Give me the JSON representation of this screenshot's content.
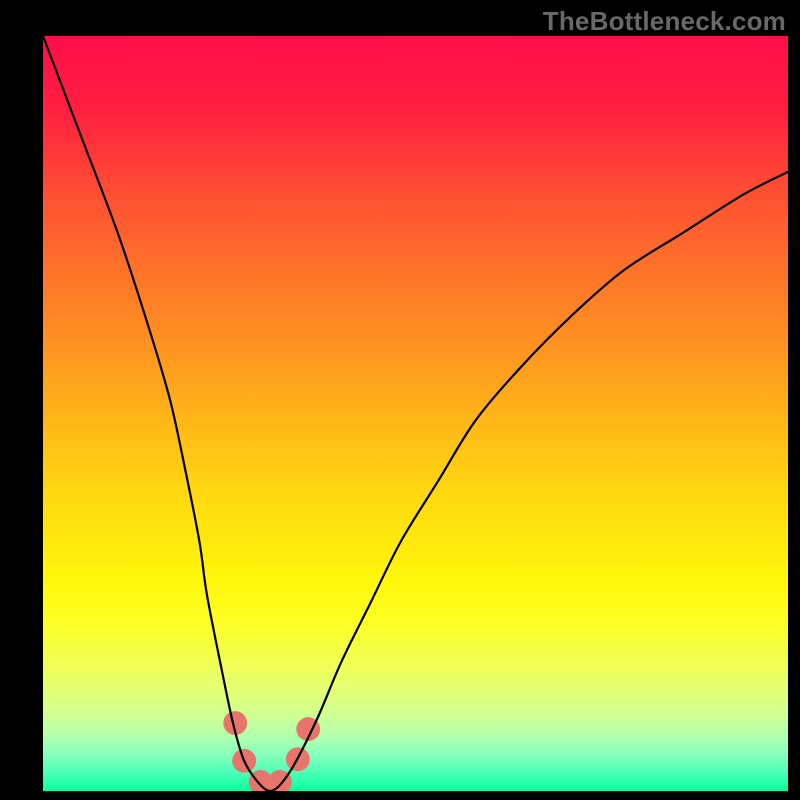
{
  "watermark": "TheBottleneck.com",
  "gradient": {
    "stops": [
      {
        "offset": 0.0,
        "color": "#ff0e49"
      },
      {
        "offset": 0.1,
        "color": "#ff2040"
      },
      {
        "offset": 0.2,
        "color": "#ff4b33"
      },
      {
        "offset": 0.3,
        "color": "#ff6f2a"
      },
      {
        "offset": 0.4,
        "color": "#ff8f22"
      },
      {
        "offset": 0.5,
        "color": "#ffb318"
      },
      {
        "offset": 0.6,
        "color": "#ffd610"
      },
      {
        "offset": 0.72,
        "color": "#fff60a"
      },
      {
        "offset": 0.77,
        "color": "#feff1f"
      },
      {
        "offset": 0.82,
        "color": "#f3ff4a"
      },
      {
        "offset": 0.86,
        "color": "#e6ff6f"
      },
      {
        "offset": 0.9,
        "color": "#cfff93"
      },
      {
        "offset": 0.925,
        "color": "#b5ffab"
      },
      {
        "offset": 0.95,
        "color": "#89ffbb"
      },
      {
        "offset": 0.975,
        "color": "#4effb7"
      },
      {
        "offset": 1.0,
        "color": "#06ff9f"
      }
    ]
  },
  "chart_data": {
    "type": "line",
    "title": "",
    "xlabel": "",
    "ylabel": "",
    "xlim": [
      0,
      100
    ],
    "ylim": [
      0,
      100
    ],
    "series": [
      {
        "name": "bottleneck-curve",
        "x": [
          0,
          5,
          10,
          14,
          17,
          19,
          21,
          22,
          24,
          25.5,
          27,
          29,
          30.5,
          32,
          34,
          37,
          40,
          44,
          48,
          53,
          58,
          64,
          71,
          78,
          86,
          94,
          100
        ],
        "values": [
          100,
          87,
          74,
          62,
          52,
          43,
          33,
          26,
          16,
          9,
          4,
          1,
          0,
          1,
          4,
          10,
          17,
          25,
          33,
          41,
          49,
          56,
          63,
          69,
          74,
          79,
          82
        ]
      }
    ],
    "markers": {
      "name": "marker-blobs",
      "color": "#e8756b",
      "points": [
        {
          "x": 25.8,
          "y": 9.0,
          "r": 1.6
        },
        {
          "x": 27.0,
          "y": 4.0,
          "r": 1.6
        },
        {
          "x": 29.2,
          "y": 1.2,
          "r": 1.6
        },
        {
          "x": 31.8,
          "y": 1.2,
          "r": 1.6
        },
        {
          "x": 34.2,
          "y": 4.2,
          "r": 1.6
        },
        {
          "x": 35.6,
          "y": 8.2,
          "r": 1.6
        }
      ]
    }
  }
}
